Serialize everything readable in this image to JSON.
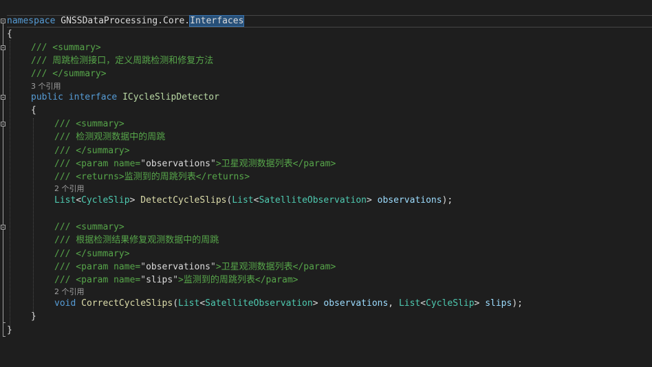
{
  "namespace": {
    "keyword": "namespace",
    "name": "GNSSDataProcessing.Core.",
    "highlight": "Interfaces"
  },
  "brace_open": "{",
  "brace_close": "}",
  "interface": {
    "doc": {
      "summary_open": "/// <summary>",
      "summary_text": "/// 周跳检测接口，定义周跳检测和修复方法",
      "summary_close": "/// </summary>"
    },
    "refs": "3 个引用",
    "modifier": "public",
    "keyword": "interface",
    "name": "ICycleSlipDetector",
    "brace_open": "{",
    "brace_close": "}"
  },
  "method1": {
    "summary_open": "/// <summary>",
    "summary_text": "/// 检测观测数据中的周跳",
    "summary_close": "/// </summary>",
    "param_prefix": "/// <param name=",
    "param_name": "observations",
    "param_text": "卫星观测数据列表",
    "param_end": "</param>",
    "returns_prefix": "/// <returns>",
    "returns_text": "监测到的周跳列表",
    "returns_end": "</returns>",
    "refs": "2 个引用",
    "return_type": "List",
    "return_generic": "CycleSlip",
    "name": "DetectCycleSlips",
    "arg_type": "List",
    "arg_generic": "SatelliteObservation",
    "arg_name": "observations"
  },
  "method2": {
    "summary_open": "/// <summary>",
    "summary_text": "/// 根据检测结果修复观测数据中的周跳",
    "summary_close": "/// </summary>",
    "param1_prefix": "/// <param name=",
    "param1_name": "observations",
    "param1_text": "卫星观测数据列表",
    "param2_name": "slips",
    "param2_text": "监测到的周跳列表",
    "param_end": "</param>",
    "refs": "2 个引用",
    "return_type": "void",
    "name": "CorrectCycleSlips",
    "arg1_type": "List",
    "arg1_generic": "SatelliteObservation",
    "arg1_name": "observations",
    "arg2_type": "List",
    "arg2_generic": "CycleSlip",
    "arg2_name": "slips"
  }
}
